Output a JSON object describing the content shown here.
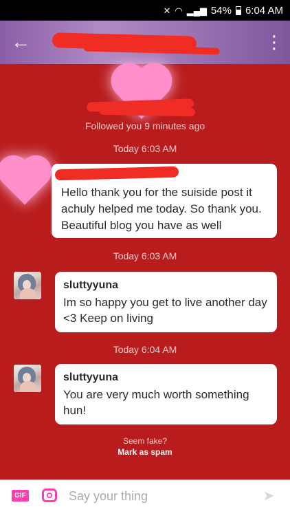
{
  "status_bar": {
    "battery": "54%",
    "time": "6:04 AM",
    "icons": [
      "mute-icon",
      "wifi-icon",
      "signal-icon",
      "battery-icon"
    ]
  },
  "header": {
    "back_icon": "back-arrow-icon",
    "menu_icon": "more-vert-icon"
  },
  "conversation": {
    "followed": "Followed you 9 minutes ago",
    "messages": [
      {
        "timestamp": "Today 6:03 AM",
        "text": "Hello thank you for the suiside post it achuly helped me today. So thank you.  Beautiful blog you have as well"
      },
      {
        "timestamp": "Today 6:03 AM",
        "sender": "sluttyyuna",
        "text": "Im so happy you get to live another day <3 Keep on living"
      },
      {
        "timestamp": "Today 6:04 AM",
        "sender": "sluttyyuna",
        "text": "You are very much worth something hun!"
      }
    ]
  },
  "spam": {
    "question": "Seem fake?",
    "action": "Mark as spam"
  },
  "composer": {
    "gif_label": "GIF",
    "placeholder": "Say your thing"
  },
  "colors": {
    "background": "#b81c1c",
    "accent": "#ff3fb1",
    "header_gradient": "#9a74b3"
  }
}
